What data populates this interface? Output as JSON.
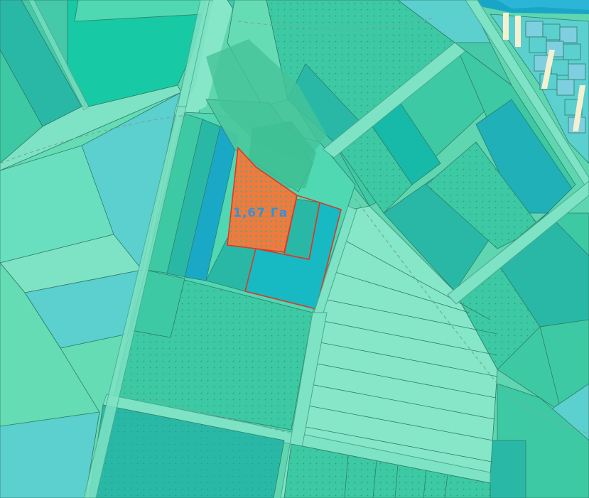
{
  "map": {
    "colors": {
      "parcel_light": "#66dcb4",
      "parcel_mid": "#3dc9a3",
      "parcel_teal": "#2ab8a6",
      "parcel_cyan": "#17b9c2",
      "parcel_blue": "#1aa8c7",
      "parcel_sky": "#5ccfcf",
      "road": "#7ee3c4",
      "boundary": "#2f7d6a",
      "selected_fill": "#f07a3c",
      "selected_stroke": "#d83a2a",
      "label_color": "#3b8fd0",
      "water": "#19a6c6",
      "building_stripe": "#f5f0d0"
    },
    "selected_parcel": {
      "area_label": "1,67 Га"
    }
  }
}
